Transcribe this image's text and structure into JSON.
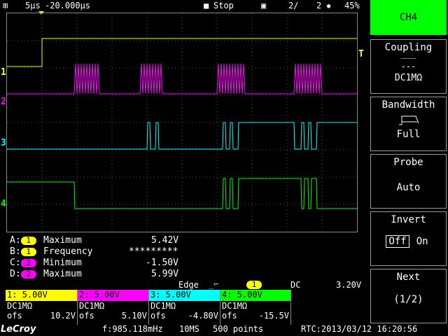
{
  "top_bar": {
    "timebase": "5µs",
    "delay": "-20.000µs",
    "state": "Stop",
    "memory": "2/",
    "memory_total": "2",
    "battery": "45%"
  },
  "trigger_marker": "T",
  "channel_markers": [
    "1",
    "2",
    "3",
    "4"
  ],
  "colors": {
    "ch1": "#ffff00",
    "ch2": "#ff00ff",
    "ch3": "#00ffff",
    "ch4": "#00ff00",
    "menu_active": "#00ff00"
  },
  "measurements": [
    {
      "slot": "A:",
      "channel": "1",
      "name": "Maximum",
      "value": "5.42V"
    },
    {
      "slot": "B:",
      "channel": "1",
      "name": "Frequency",
      "value": "*********"
    },
    {
      "slot": "C:",
      "channel": "2",
      "name": "Minimum",
      "value": "-1.50V"
    },
    {
      "slot": "D:",
      "channel": "2",
      "name": "Maximum",
      "value": "5.99V"
    }
  ],
  "trigger": {
    "type": "Edge",
    "source": "1",
    "coupling": "DC",
    "level": "3.20V"
  },
  "channels": [
    {
      "header": "1: 5.00V",
      "coupling": "DC1MΩ",
      "ofs_label": "ofs",
      "offset": "10.2V"
    },
    {
      "header": "2: 5.00V",
      "coupling": "DC1MΩ",
      "ofs_label": "ofs",
      "offset": "5.10V"
    },
    {
      "header": "3: 5.00V",
      "coupling": "DC1MΩ",
      "ofs_label": "ofs",
      "offset": "-4.80V"
    },
    {
      "header": "4: 5.00V",
      "coupling": "DC1MΩ",
      "ofs_label": "ofs",
      "offset": "-15.5V"
    }
  ],
  "bottom_bar": {
    "brand": "LeCroy",
    "freq": "f:985.118mHz",
    "rate": "10MS",
    "points": "500 points",
    "rtc": "RTC:2013/03/12 16:20:56"
  },
  "menu": {
    "title": "CH4",
    "coupling": {
      "label": "Coupling",
      "value": "DC1MΩ"
    },
    "bandwidth": {
      "label": "Bandwidth",
      "value": "Full"
    },
    "probe": {
      "label": "Probe",
      "value": "Auto"
    },
    "invert": {
      "label": "Invert",
      "off": "Off",
      "on": "On"
    },
    "next": {
      "label": "Next",
      "page": "(1/2)"
    }
  }
}
